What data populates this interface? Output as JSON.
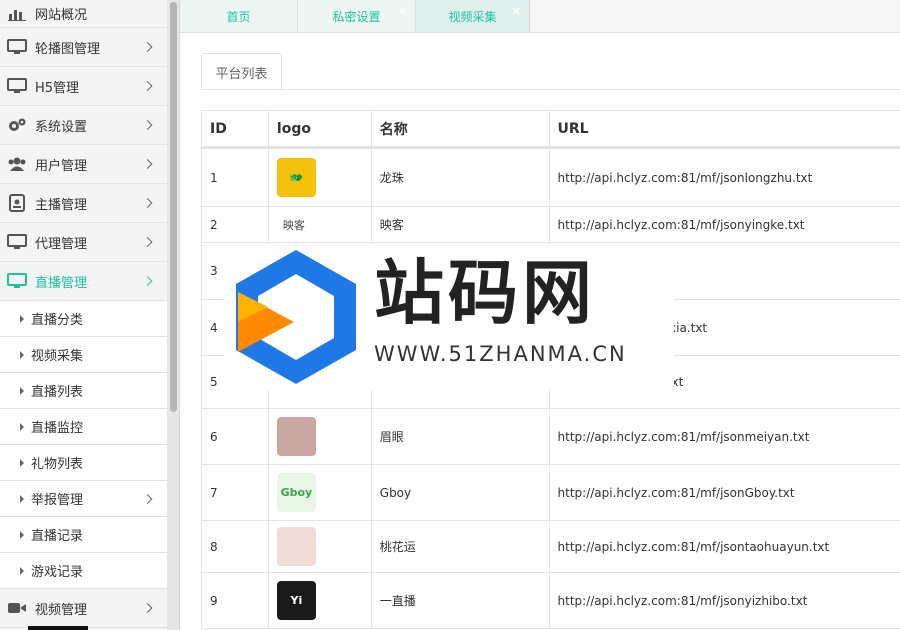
{
  "sidebar": {
    "top_item": "网站概况",
    "items": [
      {
        "label": "轮播图管理",
        "icon": "monitor-icon"
      },
      {
        "label": "H5管理",
        "icon": "monitor-icon"
      },
      {
        "label": "系统设置",
        "icon": "gears-icon"
      },
      {
        "label": "用户管理",
        "icon": "users-icon"
      },
      {
        "label": "主播管理",
        "icon": "id-card-icon"
      },
      {
        "label": "代理管理",
        "icon": "monitor-icon"
      },
      {
        "label": "直播管理",
        "icon": "monitor-icon",
        "active": true
      }
    ],
    "sub_items": [
      {
        "label": "直播分类"
      },
      {
        "label": "视频采集"
      },
      {
        "label": "直播列表"
      },
      {
        "label": "直播监控"
      },
      {
        "label": "礼物列表"
      },
      {
        "label": "举报管理",
        "has_children": true
      },
      {
        "label": "直播记录"
      },
      {
        "label": "游戏记录"
      }
    ],
    "bottom_item": {
      "label": "视频管理",
      "icon": "video-camera-icon"
    }
  },
  "tabs": [
    {
      "label": "首页",
      "closable": false
    },
    {
      "label": "私密设置",
      "closable": true
    },
    {
      "label": "视频采集",
      "closable": true
    }
  ],
  "close_glyph": "✕",
  "subtab": "平台列表",
  "table": {
    "headers": [
      "ID",
      "logo",
      "名称",
      "URL"
    ],
    "rows": [
      {
        "id": "1",
        "name": "龙珠",
        "url": "http://api.hclyz.com:81/mf/jsonlongzhu.txt",
        "logo_bg": "#f5c20b",
        "logo_text": "🐲"
      },
      {
        "id": "2",
        "name": "映客",
        "url": "http://api.hclyz.com:81/mf/jsonyingke.txt",
        "logo_bg": "#ffffff",
        "logo_text": "映客"
      },
      {
        "id": "3",
        "name": "",
        "url": "81/mf/jsonweila.txt",
        "logo_bg": "#ffffff",
        "logo_text": ""
      },
      {
        "id": "4",
        "name": "",
        "url": "81/mf/jsonxiaohuaxia.txt",
        "logo_bg": "#ffffff",
        "logo_text": ""
      },
      {
        "id": "5",
        "name": "",
        "url": "81/mf/jsonkawayi.txt",
        "logo_bg": "#ffffff",
        "logo_text": ""
      },
      {
        "id": "6",
        "name": "眉眼",
        "url": "http://api.hclyz.com:81/mf/jsonmeiyan.txt",
        "logo_bg": "#c9a7a0",
        "logo_text": ""
      },
      {
        "id": "7",
        "name": "Gboy",
        "url": "http://api.hclyz.com:81/mf/jsonGboy.txt",
        "logo_bg": "#e9f5e6",
        "logo_text": "Gboy"
      },
      {
        "id": "8",
        "name": "桃花运",
        "url": "http://api.hclyz.com:81/mf/jsontaohuayun.txt",
        "logo_bg": "#f0dcd6",
        "logo_text": ""
      },
      {
        "id": "9",
        "name": "一直播",
        "url": "http://api.hclyz.com:81/mf/jsonyizhibo.txt",
        "logo_bg": "#1a1a1a",
        "logo_text": "Yi"
      }
    ]
  },
  "watermark": {
    "title": "站码网",
    "url": "WWW.51ZHANMA.CN"
  },
  "colors": {
    "accent": "#1dc39f",
    "brand_blue": "#1e78e6",
    "brand_orange": "#ff8a00"
  }
}
